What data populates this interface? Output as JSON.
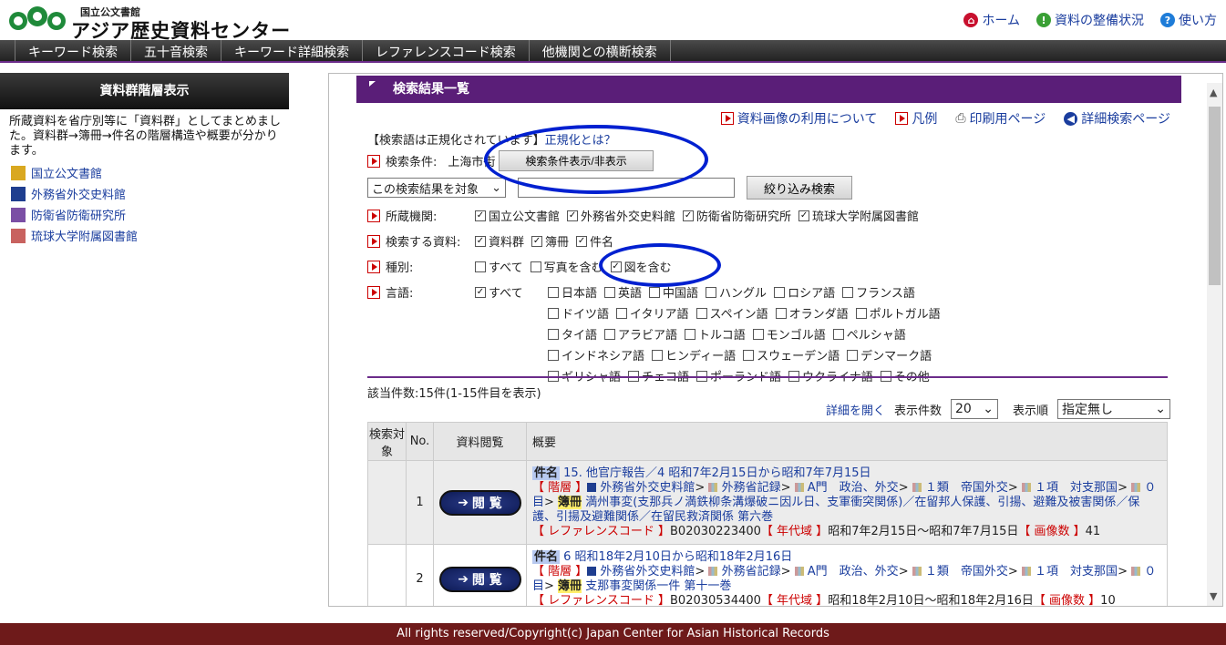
{
  "header": {
    "logo_small": "国立公文書館",
    "logo_big": "アジア歴史資料センター",
    "links": [
      {
        "label": "ホーム",
        "icon": "home-icon",
        "color": "#c8102e"
      },
      {
        "label": "資料の整備状況",
        "icon": "info-icon",
        "color": "#3aa035"
      },
      {
        "label": "使い方",
        "icon": "help-icon",
        "color": "#1e7cd8"
      }
    ]
  },
  "nav": [
    "キーワード検索",
    "五十音検索",
    "キーワード詳細検索",
    "レファレンスコード検索",
    "他機関との横断検索"
  ],
  "sidebar": {
    "title": "資料群階層表示",
    "desc": "所蔵資料を省庁別等に「資料群」としてまとめました。資料群→簿冊→件名の階層構造や概要が分かります。",
    "legend": [
      {
        "label": "国立公文書館",
        "color": "#d9a820"
      },
      {
        "label": "外務省外交史料館",
        "color": "#1f3e8f"
      },
      {
        "label": "防衛省防衛研究所",
        "color": "#7b4fa5"
      },
      {
        "label": "琉球大学附属図書館",
        "color": "#c8625f"
      }
    ]
  },
  "results": {
    "title": "検索結果一覧",
    "tools": [
      "資料画像の利用について",
      "凡例",
      "印刷用ページ",
      "詳細検索ページ"
    ],
    "normalized_note": "【検索語は正規化されています】",
    "normalized_link": "正規化とは？",
    "cond_label": "検索条件:",
    "cond_value": "上海市街",
    "toggle_button": "検索条件表示/非表示",
    "scope_select": "この検索結果を対象",
    "refine_button": "絞り込み検索",
    "org_label": "所蔵機関:",
    "orgs": [
      "国立公文書館",
      "外務省外交史料館",
      "防衛省防衛研究所",
      "琉球大学附属図書館"
    ],
    "type_label": "検索する資料:",
    "types": [
      "資料群",
      "簿冊",
      "件名"
    ],
    "kind_label": "種別:",
    "kinds": [
      {
        "label": "すべて",
        "checked": false
      },
      {
        "label": "写真を含む",
        "checked": false
      },
      {
        "label": "図を含む",
        "checked": true
      }
    ],
    "lang_label": "言語:",
    "lang_all": "すべて",
    "languages": [
      [
        "日本語",
        "英語",
        "中国語",
        "ハングル",
        "ロシア語",
        "フランス語"
      ],
      [
        "ドイツ語",
        "イタリア語",
        "スペイン語",
        "オランダ語",
        "ポルトガル語"
      ],
      [
        "タイ語",
        "アラビア語",
        "トルコ語",
        "モンゴル語",
        "ペルシャ語"
      ],
      [
        "インドネシア語",
        "ヒンディー語",
        "スウェーデン語",
        "デンマーク語"
      ],
      [
        "ギリシャ語",
        "チェコ語",
        "ポーランド語",
        "ウクライナ語",
        "その他"
      ]
    ],
    "count": "該当件数:15件(1-15件目を表示)",
    "detail_link": "詳細を開く",
    "per_page_label": "表示件数",
    "per_page": "20",
    "order_label": "表示順",
    "order": "指定無し",
    "table_headers": [
      "検索対象",
      "No.",
      "資料閲覧",
      "概要"
    ],
    "view_label": "閲 覧",
    "rows": [
      {
        "no": "1",
        "kenmei": "件名",
        "title": "15. 他官庁報告／4 昭和7年2月15日から昭和7年7月15日",
        "hierarchy_label": "【 階層 】",
        "h1": "外務省外交史料館",
        "h2": "外務省記録",
        "h3": "A門　政治、外交",
        "h4": "１類　帝国外交",
        "h5": "１項　対支那国",
        "h6": "０目",
        "book": "簿冊",
        "book_title": "満州事変(支那兵ノ満鉄柳条溝爆破ニ因ル日、支軍衝突関係)／在留邦人保護、引揚、避難及被害関係／保護、引揚及避難関係／在留民救済関係 第六巻",
        "ref_label": "【 レファレンスコード 】",
        "ref": "B02030223400",
        "era_label": "【 年代域 】",
        "era": "昭和7年2月15日～昭和7年7月15日",
        "img_label": "【 画像数 】",
        "img": "41"
      },
      {
        "no": "2",
        "kenmei": "件名",
        "title": "6 昭和18年2月10日から昭和18年2月16日",
        "hierarchy_label": "【 階層 】",
        "h1": "外務省外交史料館",
        "h2": "外務省記録",
        "h3": "A門　政治、外交",
        "h4": "１類　帝国外交",
        "h5": "１項　対支那国",
        "h6": "０目",
        "book": "簿冊",
        "book_title": "支那事変関係一件 第十一巻",
        "ref_label": "【 レファレンスコード 】",
        "ref": "B02030534400",
        "era_label": "【 年代域 】",
        "era": "昭和18年2月10日～昭和18年2月16日",
        "img_label": "【 画像数 】",
        "img": "10"
      }
    ]
  },
  "footer": "All rights reserved/Copyright(c) Japan Center for Asian Historical Records"
}
